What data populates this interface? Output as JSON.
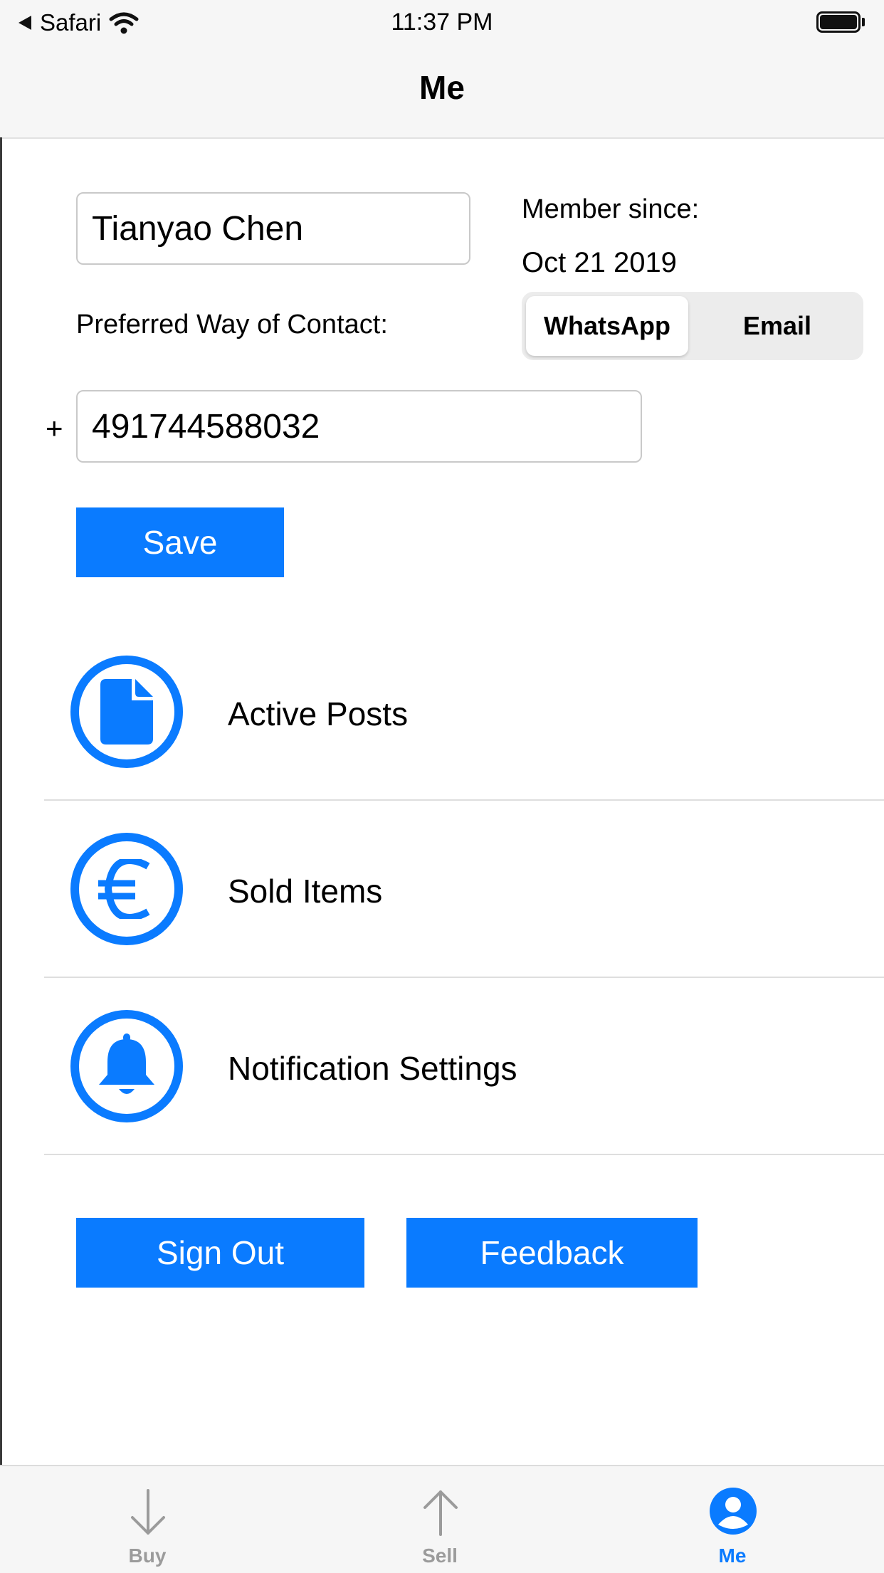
{
  "status_bar": {
    "back_app": "Safari",
    "time": "11:37 PM"
  },
  "nav": {
    "title": "Me"
  },
  "profile": {
    "name_value": "Tianyao Chen",
    "member_since_label": "Member since:",
    "member_since_date": "Oct 21 2019",
    "contact_label": "Preferred Way of Contact:",
    "contact_options": [
      "WhatsApp",
      "Email"
    ],
    "contact_selected": "WhatsApp",
    "phone_prefix": "+",
    "phone_value": "491744588032",
    "save_label": "Save"
  },
  "menu": {
    "items": [
      {
        "label": "Active Posts",
        "icon": "document-icon"
      },
      {
        "label": "Sold Items",
        "icon": "euro-icon"
      },
      {
        "label": "Notification Settings",
        "icon": "bell-icon"
      }
    ]
  },
  "actions": {
    "sign_out_label": "Sign Out",
    "feedback_label": "Feedback"
  },
  "tabbar": {
    "tabs": [
      {
        "label": "Buy",
        "icon": "arrow-down-icon",
        "active": false
      },
      {
        "label": "Sell",
        "icon": "arrow-up-icon",
        "active": false
      },
      {
        "label": "Me",
        "icon": "person-icon",
        "active": true
      }
    ]
  },
  "colors": {
    "accent": "#0a7bff",
    "tab_inactive": "#9b9b9b"
  }
}
